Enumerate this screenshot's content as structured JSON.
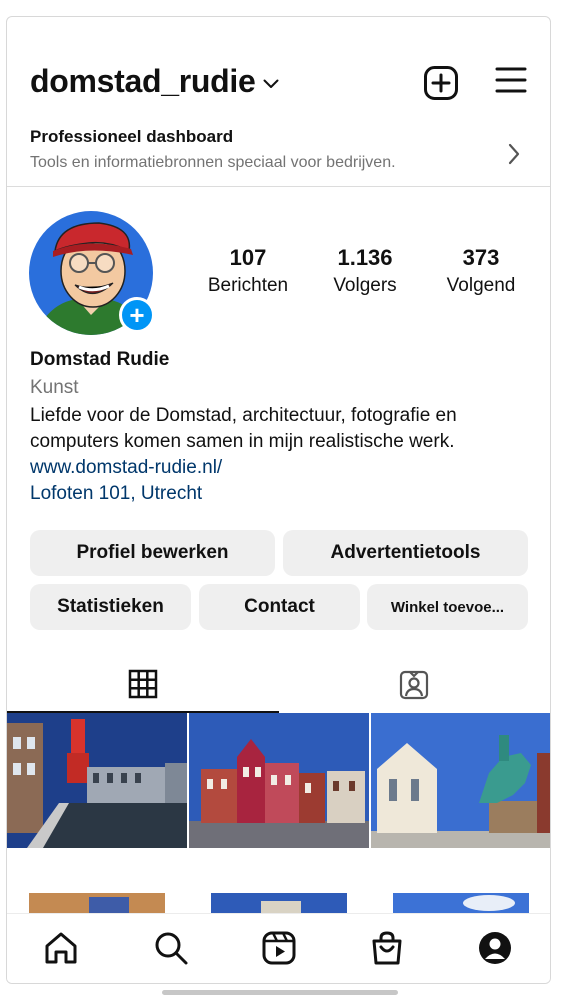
{
  "header": {
    "username": "domstad_rudie",
    "icons": {
      "dropdown": "chevron-down-icon",
      "create": "add-square-icon",
      "menu": "hamburger-menu-icon"
    }
  },
  "dashboard": {
    "title": "Professioneel dashboard",
    "subtitle": "Tools en informatiebronnen speciaal voor bedrijven.",
    "icon": "chevron-right-icon"
  },
  "profile": {
    "stats": [
      {
        "value": "107",
        "label": "Berichten"
      },
      {
        "value": "1.136",
        "label": "Volgers"
      },
      {
        "value": "373",
        "label": "Volgend"
      }
    ],
    "display_name": "Domstad Rudie",
    "category": "Kunst",
    "bio": [
      "Liefde voor de Domstad, architectuur, fotografie en",
      "computers komen samen in mijn realistische werk."
    ],
    "website": "www.domstad-rudie.nl/",
    "address": "Lofoten 101, Utrecht",
    "avatar_badge": "+"
  },
  "buttons": {
    "edit_profile": "Profiel bewerken",
    "ad_tools": "Advertentietools",
    "statistics": "Statistieken",
    "contact": "Contact",
    "shop": "Winkel toevoe..."
  },
  "tabs": {
    "icons": [
      "grid-icon",
      "tagged-icon"
    ]
  },
  "bottom_nav": {
    "icons": [
      "home-icon",
      "search-icon",
      "reels-icon",
      "shop-icon",
      "profile-icon"
    ]
  },
  "colors": {
    "accent": "#0095f6",
    "link": "#00376b",
    "muted": "#737373",
    "button_bg": "#efefef"
  }
}
